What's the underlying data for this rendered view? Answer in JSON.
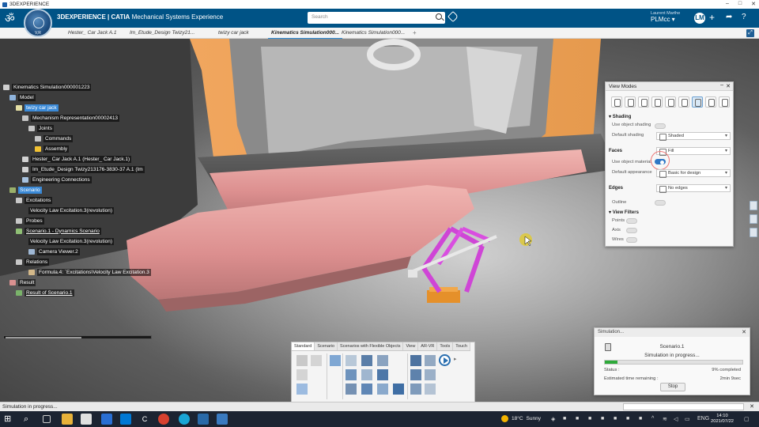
{
  "window": {
    "title": "3DEXPERIENCE"
  },
  "header": {
    "brand_prefix": "3DEXPERIENCE | CATIA",
    "brand_app": "Mechanical Systems Experience",
    "compass_label": "V,R",
    "search_placeholder": "Search",
    "user_name": "Laurent Marthe",
    "user_org": "PLMcc",
    "user_avatar": "LM"
  },
  "tabs": [
    {
      "label": "Hester_ Car Jack A.1",
      "active": false
    },
    {
      "label": "Im_Etude_Design Twizy21...",
      "active": false
    },
    {
      "label": "twizy car jack",
      "active": false
    },
    {
      "label": "Kinematics Simulation000...",
      "active": true
    },
    {
      "label": "Kinematics Simulation000...",
      "active": false
    }
  ],
  "tree": [
    {
      "label": "Kinematics Simulation000001223",
      "level": 0,
      "color": "#cfcfcf"
    },
    {
      "label": "Model",
      "level": 1,
      "color": "#8fb4dc"
    },
    {
      "label": "twizy car jack",
      "level": 2,
      "color": "#e5e0a5",
      "selected": true
    },
    {
      "label": "Mechanism Representation00002413",
      "level": 3,
      "color": "#c6c6c6"
    },
    {
      "label": "Joints",
      "level": 4,
      "color": "#c6c6c6"
    },
    {
      "label": "Commands",
      "level": 5,
      "color": "#c6c6c6"
    },
    {
      "label": "Assembly",
      "level": 5,
      "color": "#f2c233"
    },
    {
      "label": "Hester_ Car Jack A.1 (Hester_ Car Jack.1)",
      "level": 3,
      "color": "#d2d2d2"
    },
    {
      "label": "Im_Etude_Design Twizy213176-3830-37 A.1 (Im",
      "level": 3,
      "color": "#d2d2d2"
    },
    {
      "label": "Engineering Connections",
      "level": 3,
      "color": "#a7c2df"
    },
    {
      "label": "Scenario",
      "level": 1,
      "color": "#9ab06a",
      "selected": true
    },
    {
      "label": "Excitations",
      "level": 2,
      "color": "#c8c8c8"
    },
    {
      "label": "Velocity Law Excitation.3(revolution)",
      "level": 3,
      "color": "#c8c8c8"
    },
    {
      "label": "Probes",
      "level": 2,
      "color": "#c8c8c8"
    },
    {
      "label": "Scenario.1 - Dynamics Scenario",
      "level": 2,
      "color": "#8fbf75",
      "underline": true
    },
    {
      "label": "Velocity Law Excitation.3(revolution)",
      "level": 3,
      "color": "#c8c8c8"
    },
    {
      "label": "Camera Viewer.2",
      "level": 3,
      "color": "#9fb8d5"
    },
    {
      "label": "Relations",
      "level": 2,
      "color": "#c8c8c8"
    },
    {
      "label": "Formula.4: `Excitations\\Velocity Law Excitation.3",
      "level": 3,
      "color": "#d3b889"
    },
    {
      "label": "Result",
      "level": 1,
      "color": "#d99090"
    },
    {
      "label": "Result of Scenario.1",
      "level": 2,
      "color": "#7ab36a",
      "underline": true
    }
  ],
  "view_modes": {
    "title": "View Modes",
    "shading_section": "Shading",
    "use_object_shading": "Use object shading",
    "default_shading": "Default shading",
    "default_shading_value": "Shaded",
    "faces_section": "Faces",
    "faces_value": "Fill",
    "use_object_material": "Use object material",
    "default_appearance": "Default appearance",
    "default_appearance_value": "Basic for design",
    "edges_section": "Edges",
    "edges_value": "No edges",
    "outline": "Outline",
    "view_filters_section": "View Filters",
    "points": "Points",
    "axis": "Axis",
    "wires": "Wires"
  },
  "simulation": {
    "title": "Simulation...",
    "scenario": "Scenario.1",
    "message": "Simulation in progress...",
    "progress": 0.09,
    "status_label": "Status :",
    "status_value": "9% completed",
    "eta_label": "Estimated time remaining :",
    "eta_value": "2min 9sec",
    "stop_label": "Stop"
  },
  "action_bar": {
    "tabs": [
      "Standard",
      "Scenario",
      "Scenarios with Flexible Objects",
      "View",
      "AR-VR",
      "Tools",
      "Touch"
    ]
  },
  "status_bar": {
    "text": "Simulation in progress..."
  },
  "taskbar": {
    "temp": "18°C",
    "weather": "Sunny",
    "lang": "ENG",
    "time": "14:10",
    "date": "2021/07/22"
  }
}
